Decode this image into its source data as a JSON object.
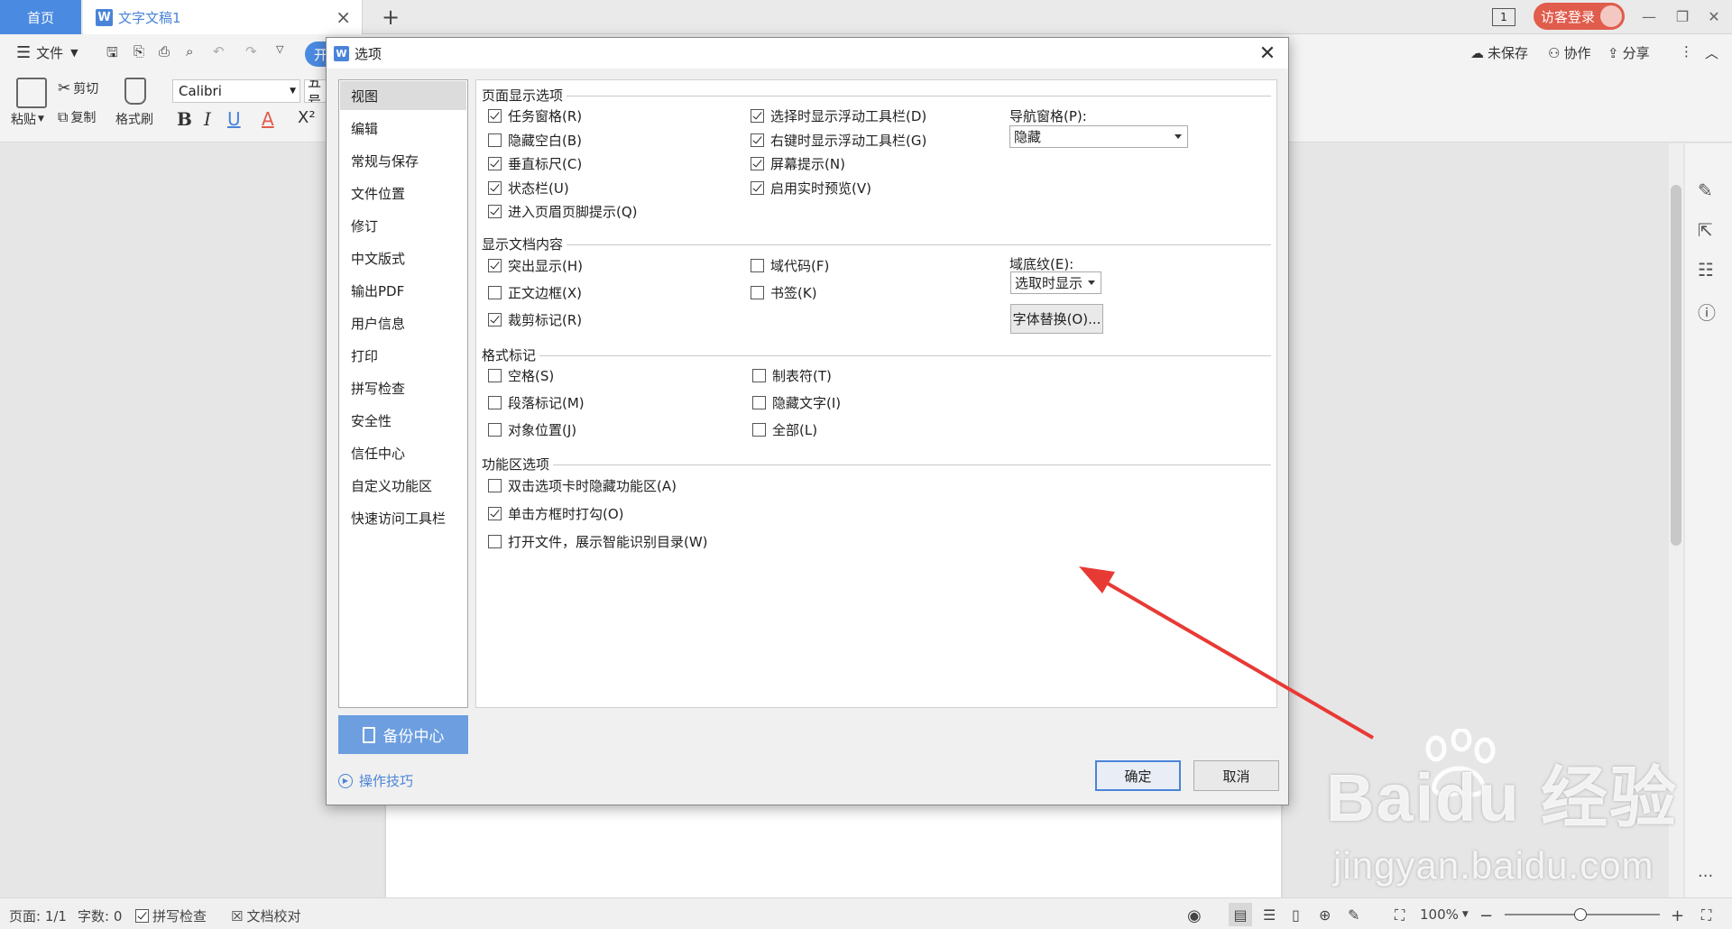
{
  "tabs": {
    "home": "首页",
    "doc": "文字文稿1"
  },
  "login": "访客登录",
  "monitor_label": "1",
  "menu": {
    "file": "文件",
    "start": "开"
  },
  "toolbar_right": {
    "unsaved": "未保存",
    "collab": "协作",
    "share": "分享"
  },
  "ribbon": {
    "paste": "粘贴",
    "cut": "剪切",
    "copy": "复制",
    "format_painter": "格式刷",
    "font": "Calibri",
    "size": "五号"
  },
  "dialog": {
    "title": "选项",
    "nav": [
      "视图",
      "编辑",
      "常规与保存",
      "文件位置",
      "修订",
      "中文版式",
      "输出PDF",
      "用户信息",
      "打印",
      "拼写检查",
      "安全性",
      "信任中心",
      "自定义功能区",
      "快速访问工具栏"
    ],
    "selected_nav": "视图",
    "backup": "备份中心",
    "tips": "操作技巧",
    "ok": "确定",
    "cancel": "取消",
    "groups": {
      "page_display": "页面显示选项",
      "doc_content": "显示文档内容",
      "format_marks": "格式标记",
      "ribbon_options": "功能区选项"
    },
    "page_display_col1": [
      {
        "label": "任务窗格(R)",
        "checked": true
      },
      {
        "label": "隐藏空白(B)",
        "checked": false
      },
      {
        "label": "垂直标尺(C)",
        "checked": true
      },
      {
        "label": "状态栏(U)",
        "checked": true
      },
      {
        "label": "进入页眉页脚提示(Q)",
        "checked": true
      }
    ],
    "page_display_col2": [
      {
        "label": "选择时显示浮动工具栏(D)",
        "checked": true
      },
      {
        "label": "右键时显示浮动工具栏(G)",
        "checked": true
      },
      {
        "label": "屏幕提示(N)",
        "checked": true
      },
      {
        "label": "启用实时预览(V)",
        "checked": true
      }
    ],
    "nav_pane_label": "导航窗格(P):",
    "nav_pane_value": "隐藏",
    "doc_content_col1": [
      {
        "label": "突出显示(H)",
        "checked": true
      },
      {
        "label": "正文边框(X)",
        "checked": false
      },
      {
        "label": "裁剪标记(R)",
        "checked": true
      }
    ],
    "doc_content_col2": [
      {
        "label": "域代码(F)",
        "checked": false
      },
      {
        "label": "书签(K)",
        "checked": false
      }
    ],
    "field_shading_label": "域底纹(E):",
    "field_shading_value": "选取时显示",
    "font_sub_button": "字体替换(O)...",
    "format_marks_col1": [
      {
        "label": "空格(S)",
        "checked": false
      },
      {
        "label": "段落标记(M)",
        "checked": false
      },
      {
        "label": "对象位置(J)",
        "checked": false
      }
    ],
    "format_marks_col2": [
      {
        "label": "制表符(T)",
        "checked": false
      },
      {
        "label": "隐藏文字(I)",
        "checked": false
      },
      {
        "label": "全部(L)",
        "checked": false
      }
    ],
    "ribbon_opts": [
      {
        "label": "双击选项卡时隐藏功能区(A)",
        "checked": false
      },
      {
        "label": "单击方框时打勾(O)",
        "checked": true
      },
      {
        "label": "打开文件，展示智能识别目录(W)",
        "checked": false
      }
    ]
  },
  "status": {
    "page": "页面: 1/1",
    "words": "字数: 0",
    "spell": "拼写检查",
    "proof": "文档校对",
    "zoom": "100%"
  },
  "watermark": {
    "brand": "Baidu 经验",
    "url": "jingyan.baidu.com"
  },
  "colors": {
    "accent": "#4a84d8",
    "login": "#e05c4c",
    "arrow": "#e83a35"
  }
}
